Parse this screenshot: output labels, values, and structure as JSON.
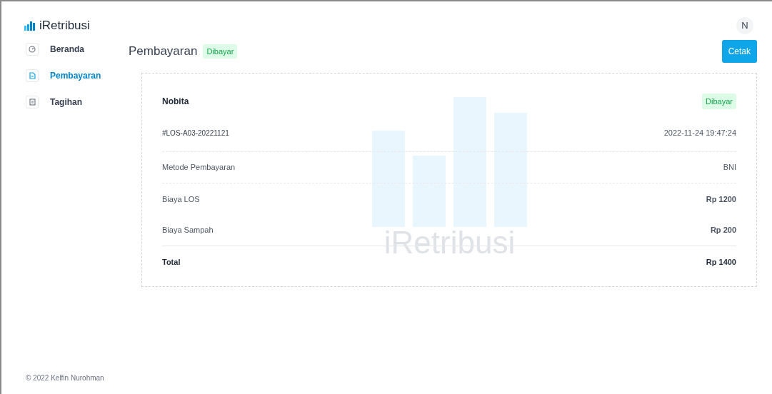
{
  "brand": "iRetribusi",
  "avatar": "N",
  "sidebar": {
    "items": [
      {
        "label": "Beranda",
        "kind": "gauge",
        "selected": false
      },
      {
        "label": "Pembayaran",
        "kind": "file",
        "selected": true
      },
      {
        "label": "Tagihan",
        "kind": "list",
        "selected": false
      }
    ]
  },
  "page": {
    "title": "Pembayaran",
    "status": "Dibayar",
    "print_button": "Cetak"
  },
  "receipt": {
    "watermark": "iRetribusi",
    "name": "Nobita",
    "status": "Dibayar",
    "code": "#LOS-A03-20221121",
    "date": "2022-11-24 19:47:24",
    "rows": [
      {
        "label": "Metode Pembayaran",
        "value": "BNI",
        "kind": "plain"
      },
      {
        "label": "Biaya LOS",
        "value": "Rp 1200",
        "kind": "fee"
      },
      {
        "label": "Biaya Sampah",
        "value": "Rp 200",
        "kind": "fee"
      },
      {
        "label": "Total",
        "value": "Rp 1400",
        "kind": "total"
      }
    ]
  },
  "footer": "© 2022 Kelfin Nurohman"
}
